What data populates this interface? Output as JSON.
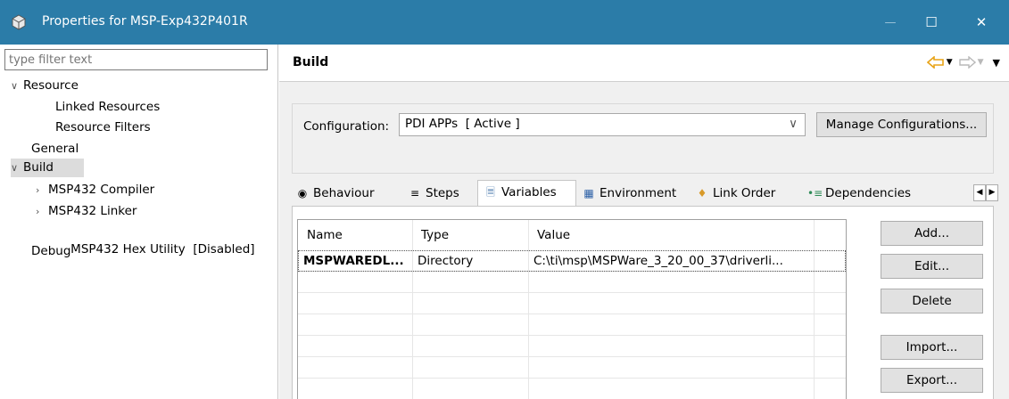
{
  "window": {
    "title": "Properties for MSP-Exp432P401R",
    "app_icon": "eclipse-properties-icon",
    "minimize": "—",
    "maximize": "☐",
    "close": "✕"
  },
  "sidebar": {
    "filter_placeholder": "type filter text",
    "items": [
      {
        "label": "Resource",
        "twisty": "expanded"
      },
      {
        "label": "Linked Resources"
      },
      {
        "label": "Resource Filters"
      },
      {
        "label": "General"
      },
      {
        "label": "Build",
        "twisty": "expanded",
        "selected": true
      },
      {
        "label": "MSP432 Compiler",
        "twisty": "collapsed"
      },
      {
        "label": "MSP432 Linker",
        "twisty": "collapsed"
      },
      {
        "label": "MSP432 Hex Utility  [Disabled]"
      },
      {
        "label": "Debug"
      }
    ]
  },
  "page": {
    "title": "Build",
    "configuration_label": "Configuration:",
    "configuration_value": "PDI APPs  [ Active ]",
    "manage_button": "Manage Configurations..."
  },
  "tabs": [
    {
      "label": "Behaviour",
      "icon": "radio-icon"
    },
    {
      "label": "Steps",
      "icon": "steps-icon"
    },
    {
      "label": "Variables",
      "icon": "variables-icon",
      "active": true
    },
    {
      "label": "Environment",
      "icon": "environment-icon"
    },
    {
      "label": "Link Order",
      "icon": "link-order-icon"
    },
    {
      "label": "Dependencies",
      "icon": "dependencies-icon"
    }
  ],
  "table": {
    "columns": [
      "Name",
      "Type",
      "Value"
    ],
    "rows": [
      {
        "name": "MSPWAREDL...",
        "type": "Directory",
        "value": "C:\\ti\\msp\\MSPWare_3_20_00_37\\driverli..."
      }
    ]
  },
  "buttons": {
    "add": "Add...",
    "edit": "Edit...",
    "delete": "Delete",
    "import": "Import...",
    "export": "Export..."
  },
  "colors": {
    "titlebar": "#2b7ca8",
    "nav_arrow": "#e8a317"
  }
}
